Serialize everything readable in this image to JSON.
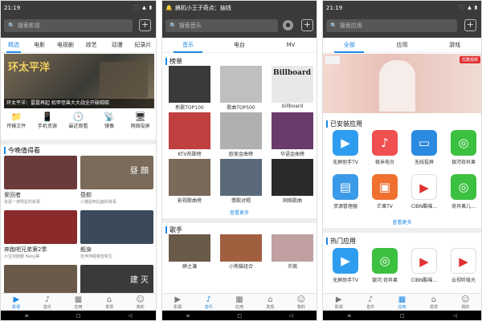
{
  "screen1": {
    "status": {
      "time": "21:19",
      "icons": "⬛ ▲ ▮"
    },
    "search": {
      "placeholder": "搜索影视"
    },
    "tabs": [
      "精选",
      "电影",
      "电视剧",
      "综艺",
      "动漫",
      "纪录片"
    ],
    "banner": {
      "logo": "环太平洋",
      "caption": "环太平洋：雷霆再起 机甲怪兽大大战全开破碳碳"
    },
    "quick": [
      {
        "icon": "📁",
        "label": "传输文件"
      },
      {
        "icon": "📱",
        "label": "手机资源"
      },
      {
        "icon": "🕒",
        "label": "最近观看"
      },
      {
        "icon": "📡",
        "label": "镜像"
      },
      {
        "icon": "🖥",
        "label": "网络投屏"
      }
    ],
    "section": "今晚值得看",
    "cards": [
      {
        "title": "爱回者",
        "sub": "张嘉一夜明星的故事",
        "color": "#6b3a3a"
      },
      {
        "title": "昼颜",
        "sub": "小猫鼠到后面的故事",
        "color": "#7a6b5a",
        "overlay": "昼 顔"
      },
      {
        "title": "奔跑吧兄弟第2季",
        "sub": "小宝剑鲍鹏 Baby等",
        "color": "#8b2a2a"
      },
      {
        "title": "舰身",
        "sub": "张萍萍跟奥智新生",
        "color": "#3a4a5a"
      },
      {
        "title": "",
        "sub": "",
        "color": "#6a5a4a"
      },
      {
        "title": "",
        "sub": "",
        "color": "#3a3a3a",
        "overlay": "建 灭"
      }
    ],
    "nav": [
      {
        "icon": "▶",
        "label": "影视"
      },
      {
        "icon": "♪",
        "label": "音乐"
      },
      {
        "icon": "▦",
        "label": "应用"
      },
      {
        "icon": "⌂",
        "label": "发现"
      },
      {
        "icon": "☺",
        "label": "我的"
      }
    ]
  },
  "screen2": {
    "status": {
      "time": "🔔",
      "title": "搞机小王子奇点：抽钱"
    },
    "search": {
      "placeholder": "搜索音乐"
    },
    "tabs": [
      "音乐",
      "电台",
      "MV"
    ],
    "section1": "榜单",
    "charts": [
      {
        "label": "新歌TOP100",
        "color": "#3a3a3a"
      },
      {
        "label": "歌曲TOP500",
        "color": "#bfbfbf"
      },
      {
        "label": "billboard",
        "color": "#e8e8e8",
        "overlay": "Billboard"
      },
      {
        "label": "KTV热歌榜",
        "color": "#c04040"
      },
      {
        "label": "欧美金曲榜",
        "color": "#b0b0b0"
      },
      {
        "label": "华语金曲榜",
        "color": "#6a3a6a"
      },
      {
        "label": "影视歌曲榜",
        "color": "#7a6a5a"
      },
      {
        "label": "情歌对唱",
        "color": "#5a6a7a"
      },
      {
        "label": "网络歌曲",
        "color": "#2a2a2a"
      }
    ],
    "more1": "查看更多",
    "section2": "歌手",
    "singers": [
      {
        "label": "薛之谦",
        "color": "#6a5a4a"
      },
      {
        "label": "小熊猫组合",
        "color": "#a06040"
      },
      {
        "label": "许嵩",
        "color": "#c0a0a0"
      }
    ],
    "nav": [
      {
        "icon": "▶",
        "label": "影视"
      },
      {
        "icon": "♪",
        "label": "音乐"
      },
      {
        "icon": "▦",
        "label": "应用"
      },
      {
        "icon": "⌂",
        "label": "发现"
      },
      {
        "icon": "☺",
        "label": "我的"
      }
    ]
  },
  "screen3": {
    "status": {
      "time": "21:19",
      "icons": "⬛ ▲ ▮"
    },
    "search": {
      "placeholder": "搜索应用"
    },
    "tabs": [
      "全部",
      "应用",
      "游戏"
    ],
    "banner": {
      "badge": "优酷视频"
    },
    "section1": "已安装应用",
    "installed": [
      {
        "label": "无屏助手TV",
        "color": "#2e9df0",
        "glyph": "▶"
      },
      {
        "label": "极米电台",
        "color": "#f05050",
        "glyph": "♪"
      },
      {
        "label": "无线投屏",
        "color": "#2a8ae0",
        "glyph": "▭"
      },
      {
        "label": "银河奇异果",
        "color": "#3cc040",
        "glyph": "◎"
      },
      {
        "label": "资源管理器",
        "color": "#3a9ae8",
        "glyph": "▤"
      },
      {
        "label": "芒果TV",
        "color": "#f07030",
        "glyph": "▣"
      },
      {
        "label": "CIBN酷喵...",
        "color": "#ffffff",
        "glyph": "▶"
      },
      {
        "label": "奇异果儿...",
        "color": "#3cc040",
        "glyph": "◎"
      }
    ],
    "more1": "查看更多",
    "section2": "热门应用",
    "hot": [
      {
        "label": "无屏助手TV",
        "color": "#2e9df0",
        "glyph": "▶"
      },
      {
        "label": "银河.奇异果",
        "color": "#3cc040",
        "glyph": "◎"
      },
      {
        "label": "CIBN酷喵...",
        "color": "#ffffff",
        "glyph": "▶"
      },
      {
        "label": "云视听极光",
        "color": "#ffffff",
        "glyph": "▶"
      }
    ],
    "nav": [
      {
        "icon": "▶",
        "label": "影视"
      },
      {
        "icon": "♪",
        "label": "音乐"
      },
      {
        "icon": "▦",
        "label": "应用"
      },
      {
        "icon": "⌂",
        "label": "发现"
      },
      {
        "icon": "☺",
        "label": "我的"
      }
    ]
  }
}
